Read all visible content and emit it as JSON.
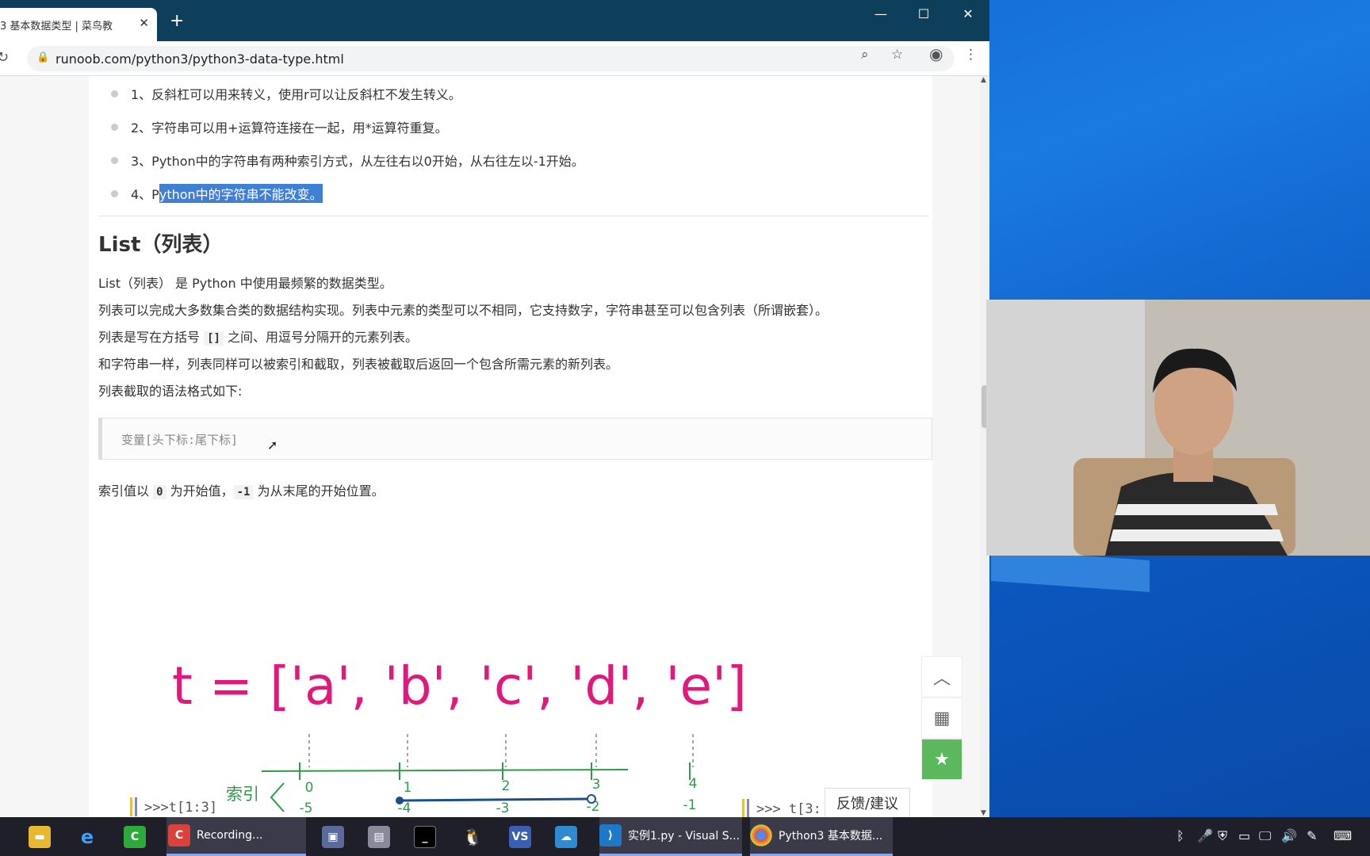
{
  "browser": {
    "tab_title": "3 基本数据类型 | 菜鸟教",
    "tab_close": "✕",
    "new_tab": "+",
    "url": "runoob.com/python3/python3-data-type.html"
  },
  "article": {
    "bullets": [
      "1、反斜杠可以用来转义，使用r可以让反斜杠不发生转义。",
      "2、字符串可以用+运算符连接在一起，用*运算符重复。",
      "3、Python中的字符串有两种索引方式，从左往右以0开始，从右往左以-1开始。"
    ],
    "bullet4_prefix": "4、P",
    "bullet4_highlight": "ython中的字符串不能改变。",
    "heading": "List（列表）",
    "p1": "List（列表） 是 Python 中使用最频繁的数据类型。",
    "p2": "列表可以完成大多数集合类的数据结构实现。列表中元素的类型可以不相同，它支持数字，字符串甚至可以包含列表（所谓嵌套）。",
    "p3_pre": "列表是写在方括号 ",
    "p3_code": "[]",
    "p3_post": " 之间、用逗号分隔开的元素列表。",
    "p4": "和字符串一样，列表同样可以被索引和截取，列表被截取后返回一个包含所需元素的新列表。",
    "p5": "列表截取的语法格式如下:",
    "code": "变量[头下标:尾下标]",
    "p6_pre": "索引值以 ",
    "p6_code1": "0",
    "p6_mid": " 为开始值，",
    "p6_code2": "-1",
    "p6_post": " 为从末尾的开始位置。"
  },
  "diagram": {
    "expression": "t = ['a', 'b', 'c', 'd', 'e']",
    "index_label": "索引",
    "pos_indices": [
      "0",
      "1",
      "2",
      "3",
      "4"
    ],
    "neg_indices": [
      "-5",
      "-4",
      "-3",
      "-2",
      "-1"
    ],
    "slice1": ">>>t[1:3]",
    "slice2": ">>> t[3:"
  },
  "side": {
    "feedback": "反馈/建议"
  },
  "taskbar": {
    "recording": "Recording...",
    "vscode": "实例1.py - Visual S...",
    "chrome": "Python3 基本数据..."
  },
  "colors": {
    "expression": "#e0197a",
    "diagram_green": "#2e9a4a",
    "slice_blue": "#1a4f8a",
    "titlebar": "#0e3f5a",
    "selection": "#3f7fd6"
  }
}
